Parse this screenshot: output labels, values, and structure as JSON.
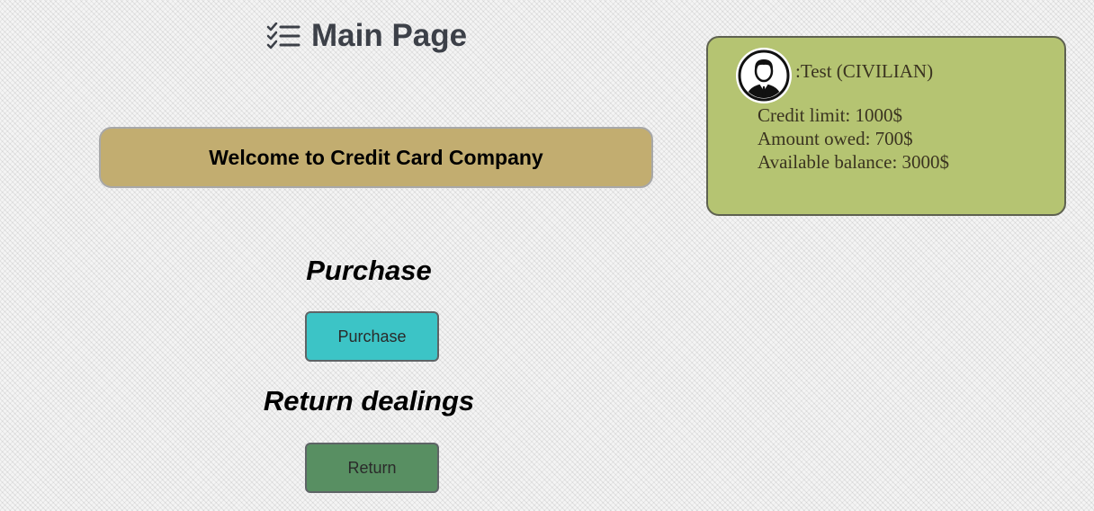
{
  "header": {
    "title": "Main Page",
    "icon": "list-checks-icon"
  },
  "banner": {
    "text": "Welcome to Credit Card Company",
    "color": "#c2ad70"
  },
  "purchase": {
    "heading": "Purchase",
    "button_label": "Purchase",
    "button_color": "#3cc4c6"
  },
  "returns": {
    "heading": "Return dealings",
    "button_label": "Return",
    "button_color": "#588f62"
  },
  "user_card": {
    "avatar_icon": "user-avatar-icon",
    "name": ":Test (CIVILIAN)",
    "credit_limit": "Credit limit: 1000$",
    "amount_owed": "Amount owed: 700$",
    "available_balance": "Available balance: 3000$",
    "color": "#b5c472"
  }
}
